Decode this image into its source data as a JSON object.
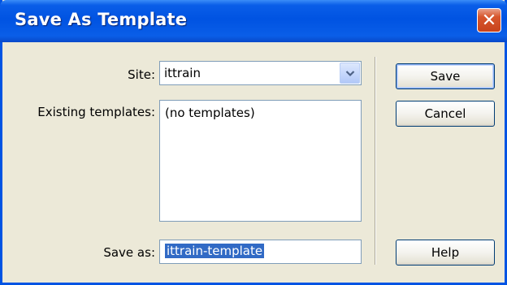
{
  "window": {
    "title": "Save As Template",
    "close_glyph": "✕"
  },
  "form": {
    "site_label": "Site:",
    "site_value": "ittrain",
    "existing_label": "Existing templates:",
    "existing_items": [
      "(no templates)"
    ],
    "save_as_label": "Save as:",
    "save_as_value": "ittrain-template"
  },
  "buttons": {
    "save": "Save",
    "cancel": "Cancel",
    "help": "Help"
  },
  "icons": {
    "dropdown": "chevron-down-icon",
    "close": "close-icon"
  },
  "colors": {
    "titlebar": "#0053e2",
    "dialog_bg": "#ece9d8",
    "selection": "#316ac5",
    "close_button": "#c8431c"
  }
}
